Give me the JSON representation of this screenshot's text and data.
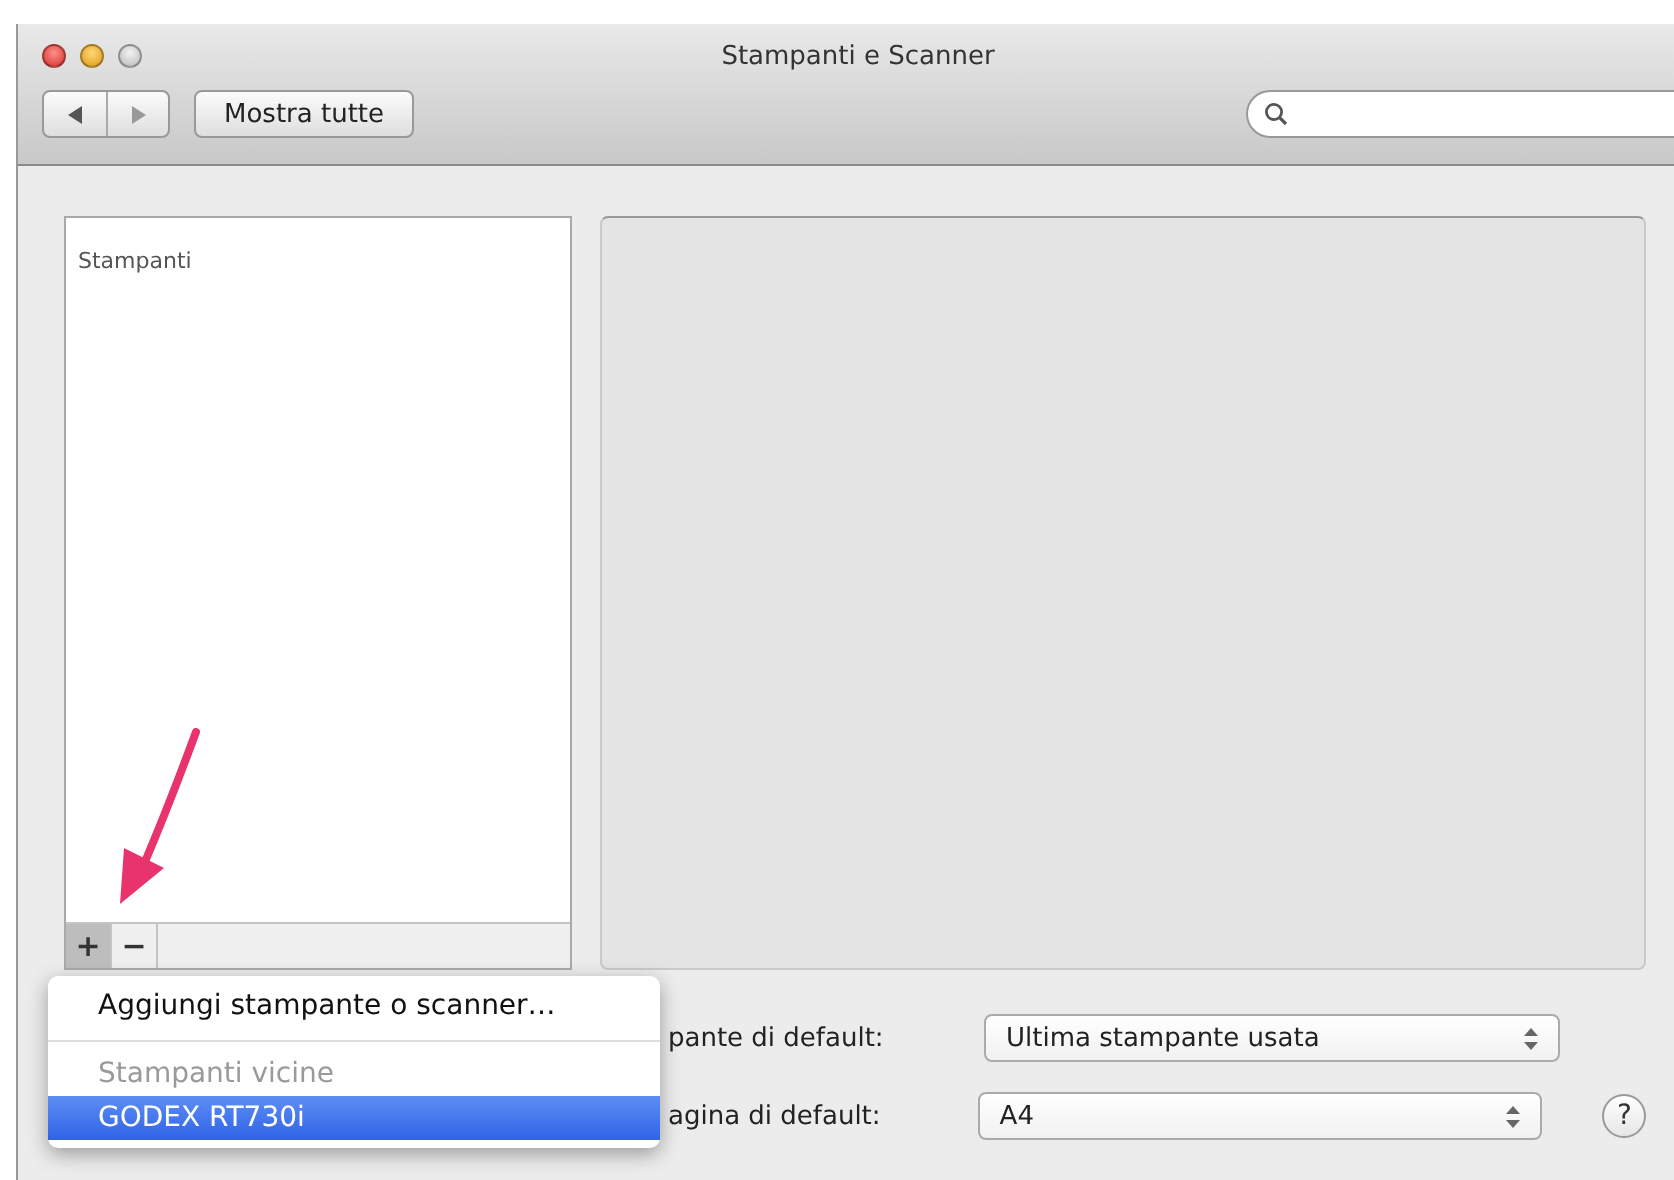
{
  "window": {
    "title": "Stampanti e Scanner"
  },
  "toolbar": {
    "show_all_button": "Mostra tutte"
  },
  "printer_list": {
    "heading": "Stampanti",
    "add_button": "+",
    "remove_button": "−"
  },
  "add_menu": {
    "items": [
      {
        "kind": "action",
        "label": "Aggiungi stampante o scanner…",
        "selected": false
      },
      {
        "kind": "separator"
      },
      {
        "kind": "header",
        "label": "Stampanti vicine"
      },
      {
        "kind": "action",
        "label": "GODEX RT730i",
        "selected": true
      }
    ]
  },
  "defaults": [
    {
      "label": "pante di default:",
      "value": "Ultima stampante usata"
    },
    {
      "label": "agina di default:",
      "value": "A4"
    }
  ],
  "help_button": "?"
}
